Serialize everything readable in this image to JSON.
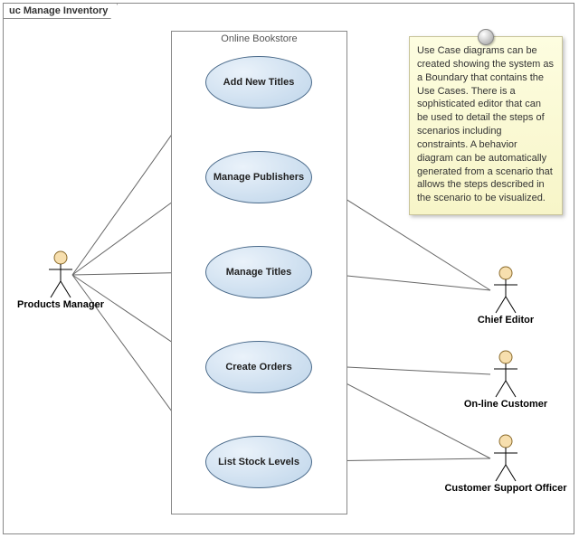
{
  "diagram": {
    "type": "uml-use-case",
    "frame_label": "uc Manage Inventory",
    "system": {
      "name": "Online Bookstore"
    },
    "use_cases": [
      {
        "id": "uc_add_new_titles",
        "label": "Add New Titles"
      },
      {
        "id": "uc_manage_publishers",
        "label": "Manage Publishers"
      },
      {
        "id": "uc_manage_titles",
        "label": "Manage Titles"
      },
      {
        "id": "uc_create_orders",
        "label": "Create Orders"
      },
      {
        "id": "uc_list_stock_levels",
        "label": "List Stock Levels"
      }
    ],
    "actors": [
      {
        "id": "actor_products_manager",
        "label": "Products Manager"
      },
      {
        "id": "actor_chief_editor",
        "label": "Chief Editor"
      },
      {
        "id": "actor_online_customer",
        "label": "On-line Customer"
      },
      {
        "id": "actor_customer_support_officer",
        "label": "Customer Support Officer"
      }
    ],
    "associations": [
      {
        "actor": "actor_products_manager",
        "usecase": "uc_add_new_titles"
      },
      {
        "actor": "actor_products_manager",
        "usecase": "uc_manage_publishers"
      },
      {
        "actor": "actor_products_manager",
        "usecase": "uc_manage_titles"
      },
      {
        "actor": "actor_products_manager",
        "usecase": "uc_create_orders"
      },
      {
        "actor": "actor_products_manager",
        "usecase": "uc_list_stock_levels"
      },
      {
        "actor": "actor_chief_editor",
        "usecase": "uc_manage_publishers"
      },
      {
        "actor": "actor_chief_editor",
        "usecase": "uc_manage_titles"
      },
      {
        "actor": "actor_online_customer",
        "usecase": "uc_create_orders"
      },
      {
        "actor": "actor_customer_support_officer",
        "usecase": "uc_create_orders"
      },
      {
        "actor": "actor_customer_support_officer",
        "usecase": "uc_list_stock_levels"
      }
    ],
    "note": {
      "text": "Use Case diagrams can be created showing the system as a Boundary that contains the Use Cases. There is a sophisticated editor that can be used to detail the steps of scenarios including constraints. A behavior diagram can be automatically generated from a scenario that allows the steps described in the scenario to be visualized."
    },
    "palette": {
      "actor_fill": "#f7dfae",
      "actor_stroke": "#8a6a2a",
      "usecase_fill": "#cfe0f0",
      "usecase_stroke": "#4a6a8a",
      "line": "#666666"
    }
  }
}
